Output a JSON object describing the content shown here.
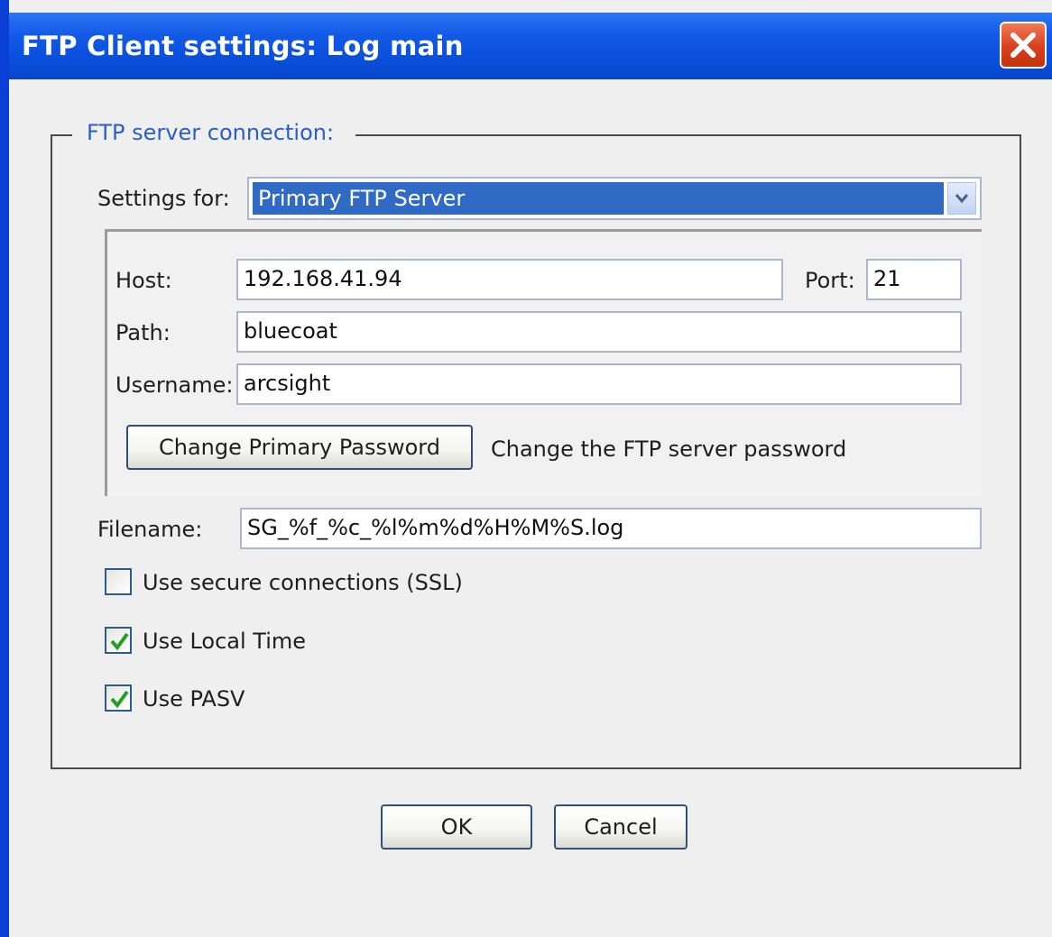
{
  "window": {
    "title": "FTP Client settings: Log main"
  },
  "group": {
    "legend": "FTP server connection:"
  },
  "settings_for": {
    "label": "Settings for:",
    "selected": "Primary FTP Server"
  },
  "host": {
    "label": "Host:",
    "value": "192.168.41.94"
  },
  "port": {
    "label": "Port:",
    "value": "21"
  },
  "path": {
    "label": "Path:",
    "value": "bluecoat"
  },
  "username": {
    "label": "Username:",
    "value": "arcsight"
  },
  "password": {
    "button_label": "Change Primary Password",
    "hint": "Change the FTP server password"
  },
  "filename": {
    "label": "Filename:",
    "value": "SG_%f_%c_%l%m%d%H%M%S.log"
  },
  "options": [
    {
      "label": "Use secure connections (SSL)",
      "checked": false
    },
    {
      "label": "Use Local Time",
      "checked": true
    },
    {
      "label": "Use PASV",
      "checked": true
    }
  ],
  "footer": {
    "ok_label": "OK",
    "cancel_label": "Cancel"
  },
  "colors": {
    "title_bar": "#0a4fdc",
    "legend_text": "#2a5fc7",
    "selection": "#316ac5",
    "check_mark": "#21a121",
    "close_button": "#d9401c"
  }
}
